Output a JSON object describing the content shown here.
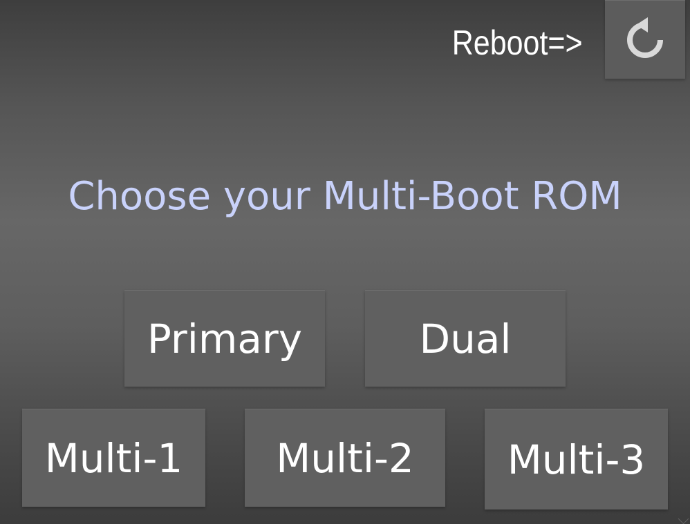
{
  "header": {
    "reboot_label": "Reboot=>",
    "reboot_icon": "restart-icon"
  },
  "main": {
    "title": "Choose your Multi-Boot ROM",
    "buttons": {
      "primary": "Primary",
      "dual": "Dual",
      "multi1": "Multi-1",
      "multi2": "Multi-2",
      "multi3": "Multi-3"
    }
  },
  "colors": {
    "title_text": "#c9d2fb",
    "button_bg": "#606060",
    "button_text": "#ffffff",
    "icon": "#d9d9d9"
  }
}
